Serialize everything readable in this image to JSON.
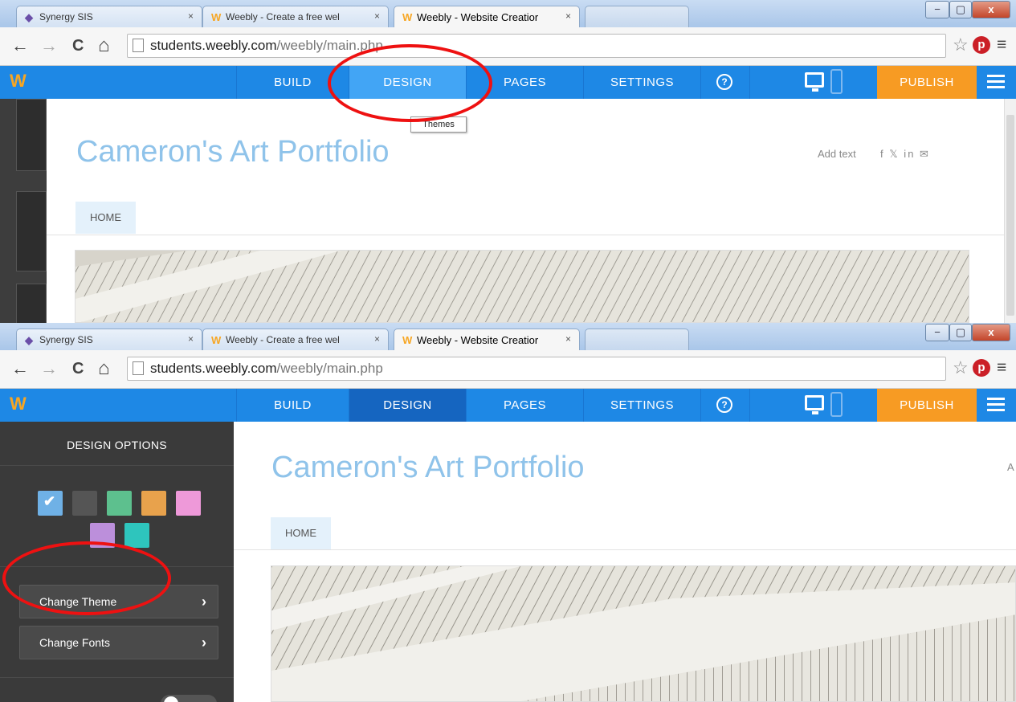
{
  "browser": {
    "tabs": [
      "Synergy SIS",
      "Weebly - Create a free wel",
      "Weebly - Website Creatior"
    ],
    "url_host": "students.weebly.com",
    "url_path": "/weebly/main.php",
    "tab_close": "×",
    "win_min": "−",
    "win_max": "▢",
    "win_close": "x",
    "back": "←",
    "forward": "→",
    "reload": "C",
    "home": "⌂",
    "star": "☆",
    "pinterest": "p",
    "menu": "≡"
  },
  "weebly_nav": {
    "logo": "W",
    "build": "BUILD",
    "design": "DESIGN",
    "pages": "PAGES",
    "settings": "SETTINGS",
    "help": "?",
    "publish": "PUBLISH"
  },
  "tooltip": "Themes",
  "site": {
    "title": "Cameron's Art Portfolio",
    "add_text": "Add text",
    "social": "f 𝕏 in ✉",
    "nav_home": "HOME",
    "add_text_cut": "A"
  },
  "design_panel": {
    "title": "DESIGN OPTIONS",
    "swatches": [
      "#6fb1e6",
      "#555555",
      "#5dc08e",
      "#e8a24c",
      "#ee99d9",
      "#bc8fdb",
      "#2ec5bd"
    ],
    "selected_check": "✔",
    "change_theme": "Change Theme",
    "change_fonts": "Change Fonts",
    "chevron": "›"
  },
  "colors": {
    "weebly_blue": "#1e88e5",
    "publish_orange": "#f79b23",
    "annotation_red": "#e11111"
  }
}
